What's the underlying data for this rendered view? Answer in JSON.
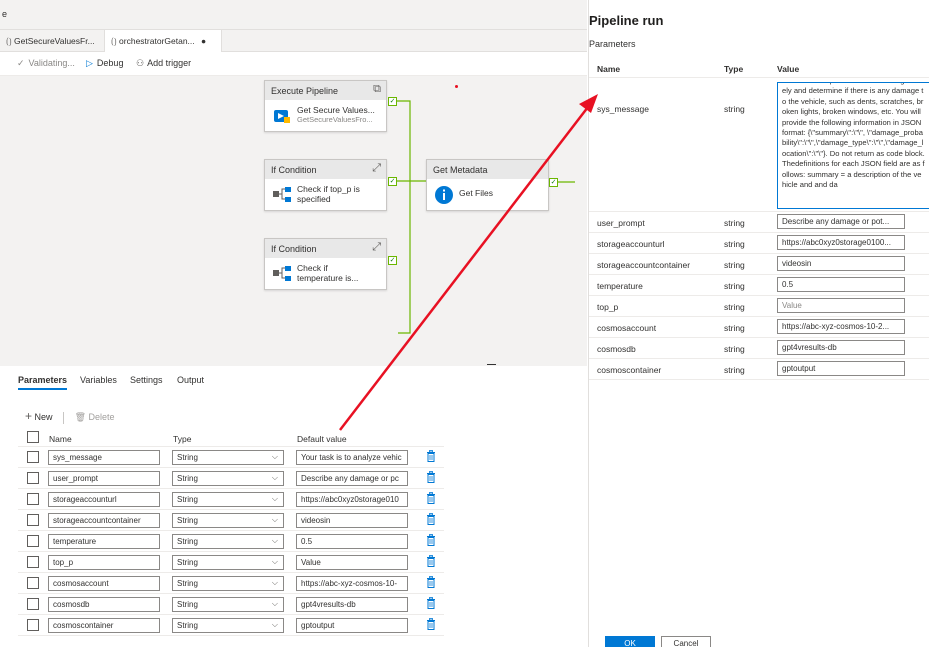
{
  "top": {
    "fragment": "e"
  },
  "tabs": [
    {
      "label": "GetSecureValuesFr..."
    },
    {
      "label": "orchestratorGetan...",
      "dot": "●"
    }
  ],
  "toolbar": {
    "validating": "Validating...",
    "debug": "Debug",
    "add_trigger": "Add trigger"
  },
  "nodes": {
    "execute": {
      "header": "Execute Pipeline",
      "title": "Get Secure Values...",
      "subtitle": "GetSecureValuesFro..."
    },
    "if1": {
      "header": "If Condition",
      "line1": "Check if top_p is",
      "line2": "specified"
    },
    "if2": {
      "header": "If Condition",
      "line1": "Check if",
      "line2": "temperature is..."
    },
    "getmeta": {
      "header": "Get Metadata",
      "title": "Get Files"
    }
  },
  "bottom_tabs": [
    "Parameters",
    "Variables",
    "Settings",
    "Output"
  ],
  "actions": {
    "new": "New",
    "delete": "Delete"
  },
  "params_table": {
    "headers": {
      "name": "Name",
      "type": "Type",
      "default": "Default value"
    },
    "rows": [
      {
        "name": "sys_message",
        "type": "String",
        "value": "Your task is to analyze vehic"
      },
      {
        "name": "user_prompt",
        "type": "String",
        "value": "Describe any damage or pc"
      },
      {
        "name": "storageaccounturl",
        "type": "String",
        "value": "https://abc0xyz0storage010"
      },
      {
        "name": "storageaccountcontainer",
        "type": "String",
        "value": "videosin"
      },
      {
        "name": "temperature",
        "type": "String",
        "value": "0.5"
      },
      {
        "name": "top_p",
        "type": "String",
        "value": "Value"
      },
      {
        "name": "cosmosaccount",
        "type": "String",
        "value": "https://abc-xyz-cosmos-10-"
      },
      {
        "name": "cosmosdb",
        "type": "String",
        "value": "gpt4vresults-db"
      },
      {
        "name": "cosmoscontainer",
        "type": "String",
        "value": "gptoutput"
      }
    ]
  },
  "dialog": {
    "title": "Pipeline run",
    "subtitle": "Parameters",
    "headers": {
      "name": "Name",
      "type": "Type",
      "value": "Value"
    },
    "sys_message": {
      "name": "sys_message",
      "type": "string",
      "text": "ou need to inspect the video or image closely and determine if there is any damage to the vehicle, such as dents, scratches, broken lights, broken windows, etc. You will provide the following information in JSON format: {\\\"summary\\\":\\\"\\\", \\\"damage_probability\\\":\\\"\\\",\\\"damage_type\\\":\\\"\\\",\\\"damage_location\\\":\\\"\\\"}.  Do not return as code block. Thedefinitions for each JSON field are as follows: summary = a description of the vehicle and and da"
    },
    "rows": [
      {
        "name": "user_prompt",
        "type": "string",
        "value": "Describe any damage or pot..."
      },
      {
        "name": "storageaccounturl",
        "type": "string",
        "value": "https://abc0xyz0storage0100..."
      },
      {
        "name": "storageaccountcontainer",
        "type": "string",
        "value": "videosin"
      },
      {
        "name": "temperature",
        "type": "string",
        "value": "0.5"
      },
      {
        "name": "top_p",
        "type": "string",
        "value": "Value"
      },
      {
        "name": "cosmosaccount",
        "type": "string",
        "value": "https://abc-xyz-cosmos-10-2..."
      },
      {
        "name": "cosmosdb",
        "type": "string",
        "value": "gpt4vresults-db"
      },
      {
        "name": "cosmoscontainer",
        "type": "string",
        "value": "gptoutput"
      }
    ],
    "ok": "OK",
    "cancel": "Cancel"
  },
  "colors": {
    "accent": "#0078d4",
    "success": "#107c10",
    "annotation": "#e81123"
  }
}
